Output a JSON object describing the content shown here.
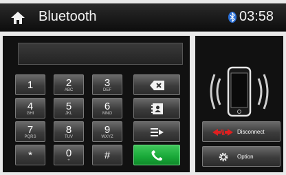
{
  "header": {
    "title": "Bluetooth",
    "clock": "03:58"
  },
  "keypad": {
    "keys": [
      {
        "main": "1",
        "sub": ""
      },
      {
        "main": "2",
        "sub": "ABC"
      },
      {
        "main": "3",
        "sub": "DEF"
      },
      {
        "main": "4",
        "sub": "GHI"
      },
      {
        "main": "5",
        "sub": "JKL"
      },
      {
        "main": "6",
        "sub": "MNO"
      },
      {
        "main": "7",
        "sub": "PQRS"
      },
      {
        "main": "8",
        "sub": "TUV"
      },
      {
        "main": "9",
        "sub": "WXYZ"
      },
      {
        "main": "*",
        "sub": ""
      },
      {
        "main": "0",
        "sub": "+"
      },
      {
        "main": "#",
        "sub": ""
      }
    ]
  },
  "side_panel": {
    "disconnect_label": "Disconnect",
    "option_label": "Option"
  },
  "icons": [
    "home-icon",
    "bluetooth-icon",
    "backspace-icon",
    "contacts-icon",
    "call-log-icon",
    "call-icon",
    "phone-signal-icon",
    "disconnect-icon",
    "gear-icon"
  ],
  "colors": {
    "call_button": "#18a838",
    "disconnect_icon": "#e02020",
    "topbar": "#0d0d0d"
  }
}
